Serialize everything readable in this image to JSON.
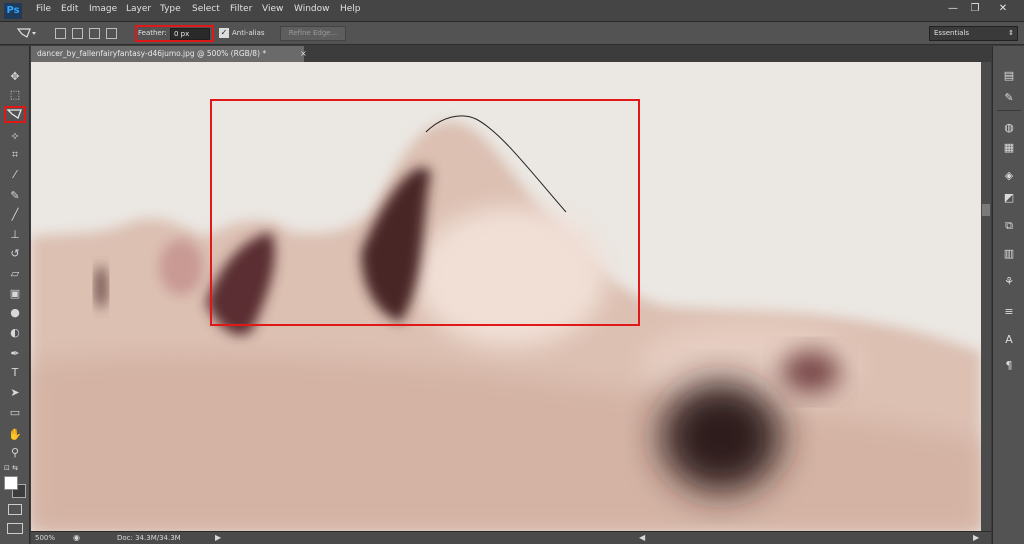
{
  "app": {
    "logo": "Ps"
  },
  "menu": [
    "File",
    "Edit",
    "Image",
    "Layer",
    "Type",
    "Select",
    "Filter",
    "View",
    "Window",
    "Help"
  ],
  "window_controls": {
    "minimize": "—",
    "restore": "❐",
    "close": "✕"
  },
  "options": {
    "feather_label": "Feather:",
    "feather_value": "0 px",
    "antialias_label": "Anti-alias",
    "antialias_checked": true,
    "antialias_mark": "✓",
    "refine_edge": "Refine Edge...",
    "workspace": "Essentials",
    "workspace_arrow": "⇕"
  },
  "document": {
    "tab_title": "dancer_by_fallenfairyfantasy-d46jumo.jpg @ 500% (RGB/8) *",
    "close": "×"
  },
  "status": {
    "zoom": "500%",
    "doc_size": "Doc: 34.3M/34.3M"
  },
  "tools": [
    "move-tool",
    "marquee-tool",
    "polygonal-lasso-tool",
    "quick-selection-tool",
    "crop-tool",
    "eyedropper-tool",
    "spot-healing-tool",
    "brush-tool",
    "clone-stamp-tool",
    "history-brush-tool",
    "eraser-tool",
    "gradient-tool",
    "blur-tool",
    "dodge-tool",
    "pen-tool",
    "type-tool",
    "path-selection-tool",
    "shape-tool",
    "hand-tool",
    "zoom-tool"
  ],
  "colors": {
    "highlight": "#e01818",
    "foreground": "#ffffff",
    "background": "#3c3c3c"
  }
}
